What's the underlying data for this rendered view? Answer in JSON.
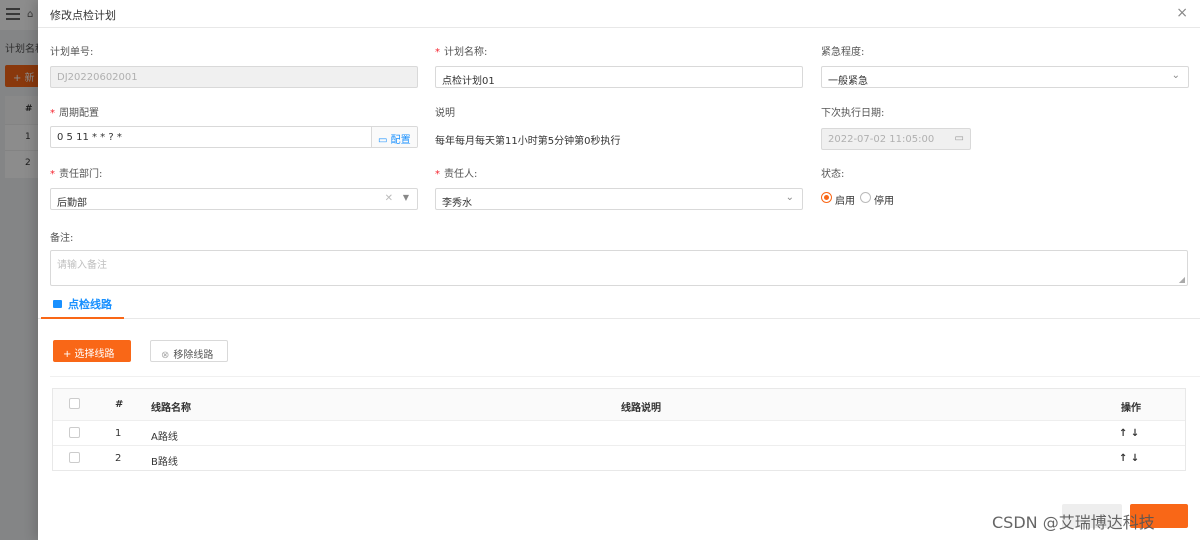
{
  "background": {
    "home_icon": "⌂",
    "filter_label": "计划名称",
    "add_button": "+ 新",
    "table_header": "#",
    "rows": [
      "1",
      "2"
    ]
  },
  "drawer": {
    "title": "修改点检计划",
    "close_icon": "×"
  },
  "form": {
    "plan_no": {
      "label": "计划单号:",
      "value": "DJ20220602001"
    },
    "plan_name": {
      "label": "计划名称:",
      "value": "点检计划01"
    },
    "urgency": {
      "label": "紧急程度:",
      "value": "一般紧急"
    },
    "cycle": {
      "label": "周期配置",
      "value": "0 5 11 * * ? *",
      "config_button": "配置"
    },
    "description": {
      "label": "说明",
      "value": "每年每月每天第11小时第5分钟第0秒执行"
    },
    "next_date": {
      "label": "下次执行日期:",
      "value": "2022-07-02 11:05:00"
    },
    "department": {
      "label": "责任部门:",
      "value": "后勤部"
    },
    "person": {
      "label": "责任人:",
      "value": "李秀水"
    },
    "status": {
      "label": "状态:",
      "options": [
        "启用",
        "停用"
      ],
      "selected": "启用"
    },
    "remark": {
      "label": "备注:",
      "placeholder": "请输入备注"
    }
  },
  "tabs": [
    {
      "label": "点检线路",
      "active": true
    }
  ],
  "toolbar": {
    "select_route": "+ 选择线路",
    "remove_route": "移除线路"
  },
  "table": {
    "columns": [
      "#",
      "线路名称",
      "线路说明",
      "操作"
    ],
    "rows": [
      {
        "index": "1",
        "name": "A路线",
        "desc": "",
        "ops": "↑ ↓"
      },
      {
        "index": "2",
        "name": "B路线",
        "desc": "",
        "ops": "↑ ↓"
      }
    ]
  },
  "watermark": "CSDN @艾瑞博达科技",
  "colors": {
    "accent": "#f96717",
    "link": "#1890ff",
    "required": "#f5222d"
  }
}
